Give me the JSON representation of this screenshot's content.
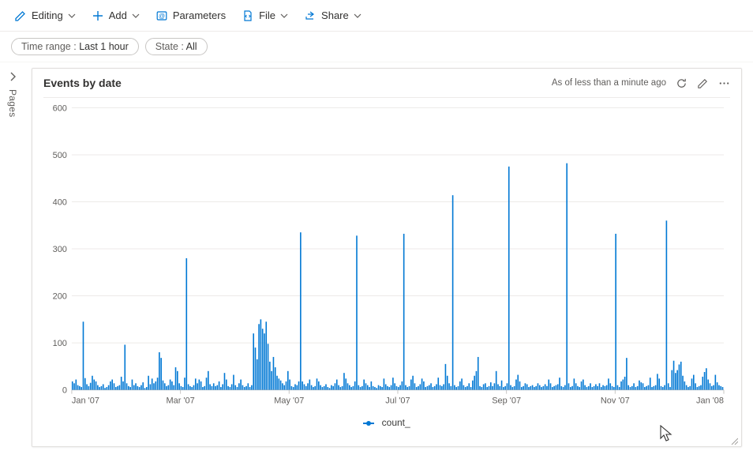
{
  "toolbar": {
    "editing": "Editing",
    "add": "Add",
    "parameters": "Parameters",
    "file": "File",
    "share": "Share"
  },
  "filters": {
    "timerange_label": "Time range :",
    "timerange_value": "Last 1 hour",
    "state_label": "State :",
    "state_value": "All"
  },
  "sidebar": {
    "pages": "Pages"
  },
  "card": {
    "title": "Events by date",
    "status": "As of less than a minute ago",
    "legend_series": "count_"
  },
  "chart_data": {
    "type": "bar",
    "title": "Events by date",
    "xlabel": "",
    "ylabel": "",
    "ylim": [
      0,
      600
    ],
    "y_ticks": [
      0,
      100,
      200,
      300,
      400,
      500,
      600
    ],
    "x_tick_labels": [
      "Jan '07",
      "Mar '07",
      "May '07",
      "Jul '07",
      "Sep '07",
      "Nov '07",
      "Jan '08"
    ],
    "series": [
      {
        "name": "count_",
        "color": "#0078d4",
        "values": [
          18,
          14,
          22,
          10,
          8,
          6,
          145,
          25,
          12,
          8,
          15,
          30,
          22,
          18,
          10,
          6,
          8,
          12,
          4,
          6,
          10,
          18,
          22,
          14,
          6,
          8,
          10,
          28,
          18,
          96,
          14,
          8,
          6,
          22,
          10,
          14,
          8,
          6,
          10,
          16,
          4,
          6,
          30,
          12,
          24,
          14,
          18,
          26,
          80,
          68,
          20,
          14,
          8,
          10,
          22,
          18,
          10,
          48,
          40,
          14,
          8,
          6,
          26,
          280,
          12,
          8,
          6,
          10,
          24,
          14,
          22,
          18,
          6,
          8,
          26,
          40,
          12,
          8,
          14,
          8,
          10,
          18,
          6,
          12,
          36,
          22,
          8,
          6,
          12,
          32,
          10,
          6,
          14,
          22,
          10,
          6,
          8,
          14,
          6,
          10,
          120,
          90,
          65,
          140,
          150,
          130,
          120,
          145,
          98,
          60,
          40,
          70,
          48,
          30,
          24,
          20,
          14,
          10,
          18,
          40,
          22,
          8,
          6,
          12,
          10,
          18,
          335,
          18,
          12,
          8,
          14,
          22,
          10,
          6,
          8,
          24,
          18,
          10,
          6,
          8,
          12,
          6,
          4,
          10,
          8,
          14,
          22,
          10,
          6,
          8,
          36,
          24,
          14,
          10,
          6,
          8,
          18,
          328,
          10,
          6,
          8,
          22,
          14,
          10,
          6,
          18,
          8,
          6,
          4,
          10,
          8,
          6,
          24,
          12,
          8,
          6,
          10,
          26,
          14,
          8,
          6,
          10,
          18,
          332,
          10,
          6,
          8,
          22,
          30,
          14,
          6,
          8,
          12,
          24,
          18,
          6,
          8,
          10,
          14,
          6,
          8,
          12,
          26,
          10,
          8,
          12,
          55,
          30,
          14,
          8,
          414,
          10,
          6,
          8,
          18,
          24,
          10,
          6,
          8,
          14,
          6,
          20,
          30,
          40,
          70,
          8,
          6,
          12,
          14,
          6,
          8,
          16,
          8,
          14,
          40,
          12,
          8,
          20,
          6,
          8,
          14,
          475,
          10,
          6,
          8,
          22,
          32,
          18,
          6,
          8,
          14,
          12,
          6,
          8,
          10,
          6,
          8,
          14,
          10,
          6,
          8,
          12,
          8,
          22,
          14,
          6,
          8,
          10,
          12,
          26,
          8,
          6,
          10,
          482,
          14,
          6,
          8,
          24,
          14,
          8,
          6,
          18,
          22,
          10,
          6,
          8,
          14,
          6,
          8,
          12,
          8,
          14,
          6,
          10,
          8,
          10,
          24,
          14,
          8,
          6,
          332,
          10,
          6,
          18,
          22,
          28,
          68,
          10,
          6,
          8,
          14,
          6,
          8,
          20,
          16,
          14,
          6,
          8,
          10,
          26,
          6,
          8,
          10,
          34,
          24,
          8,
          6,
          10,
          360,
          14,
          6,
          42,
          62,
          36,
          42,
          54,
          60,
          30,
          18,
          10,
          6,
          8,
          24,
          32,
          14,
          6,
          8,
          10,
          28,
          38,
          46,
          22,
          14,
          8,
          10,
          32,
          16,
          10,
          8,
          6
        ]
      }
    ]
  }
}
